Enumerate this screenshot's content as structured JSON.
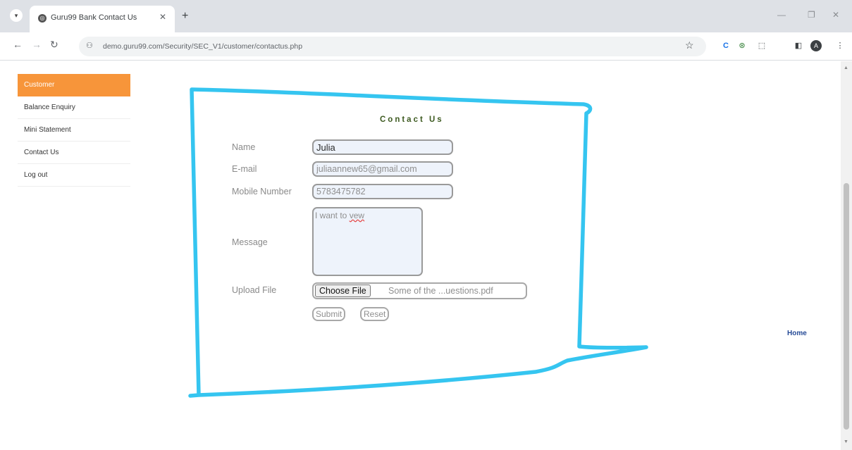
{
  "browser": {
    "tab_title": "Guru99 Bank Contact Us",
    "url": "demo.guru99.com/Security/SEC_V1/customer/contactus.php",
    "profile_initial": "A",
    "extension_c": "C"
  },
  "sidebar": {
    "items": [
      {
        "label": "Customer",
        "active": true
      },
      {
        "label": "Balance Enquiry"
      },
      {
        "label": "Mini Statement"
      },
      {
        "label": "Contact Us"
      },
      {
        "label": "Log out"
      }
    ]
  },
  "form": {
    "heading": "Contact Us",
    "name_label": "Name",
    "name_value": "Julia",
    "email_label": "E-mail",
    "email_value": "juliaannew65@gmail.com",
    "mobile_label": "Mobile Number",
    "mobile_value": "5783475782",
    "message_label": "Message",
    "message_value_prefix": "I want to ",
    "message_value_misspelled": "vew",
    "upload_label": "Upload File",
    "choose_file_label": "Choose File",
    "file_name": "Some of the ...uestions.pdf",
    "submit_label": "Submit",
    "reset_label": "Reset"
  },
  "home_link": "Home",
  "colors": {
    "sidebar_active": "#f7953a",
    "annotation_stroke": "#35c5f0",
    "heading": "#3d5a20",
    "home_link": "#254a96"
  },
  "icons": [
    "tab-search-icon",
    "site-favicon-icon",
    "close-tab-icon",
    "new-tab-icon",
    "back-icon",
    "forward-icon",
    "reload-icon",
    "site-info-icon",
    "bookmark-star-icon",
    "extensions-icon",
    "sidepanel-icon",
    "profile-avatar-icon",
    "menu-kebab-icon"
  ]
}
